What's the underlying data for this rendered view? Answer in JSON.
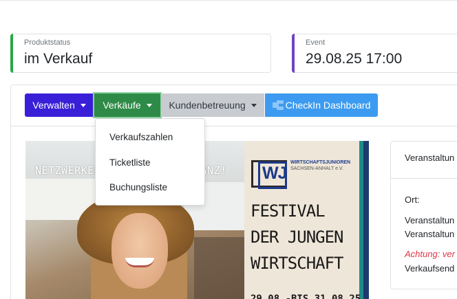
{
  "status_cards": [
    {
      "label": "Produktstatus",
      "value": "im Verkauf",
      "accent": "#28a745"
    },
    {
      "label": "Event",
      "value": "29.08.25 17:00",
      "accent": "#6f42c1"
    }
  ],
  "toolbar": {
    "verwalten": "Verwalten",
    "verkaeufe": "Verkäufe",
    "kundenbetreuung": "Kundenbetreuung",
    "checkin": "CheckIn Dashboard"
  },
  "dropdown": {
    "items": [
      "Verkaufszahlen",
      "Ticketliste",
      "Buchungsliste"
    ]
  },
  "banner": {
    "slogan_left": "NETZWERKEN",
    "slogan_right": "TANZ!",
    "org_line1": "WIRTSCHAFTSJUNIOREN",
    "org_line2": "SACHSEN-ANHALT e.V.",
    "logo": "WJ",
    "title_lines": [
      "FESTIVAL",
      "DER JUNGEN",
      "WIRTSCHAFT"
    ],
    "date": "29.08.-BIS 31.08.25"
  },
  "side_card": {
    "header": "Veranstaltun",
    "ort_label": "Ort:",
    "line1": "Veranstaltun",
    "line2": "Veranstaltun",
    "warning": "Achtung: ver",
    "line3": "Verkaufsend"
  },
  "colors": {
    "verwalten": "#3a1fd8",
    "verkaeufe": "#2e8b47",
    "kundenbetreuung": "#c8cbd0",
    "checkin": "#3c9bf0"
  }
}
